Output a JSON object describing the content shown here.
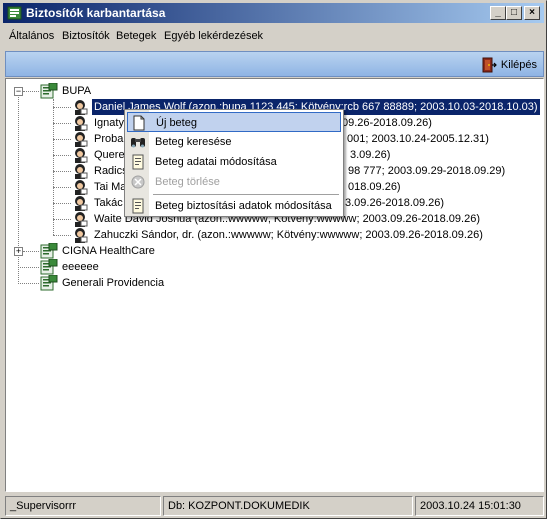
{
  "window": {
    "title": "Biztosítók karbantartása",
    "controls": {
      "minimize": "_",
      "maximize": "□",
      "close": "×"
    }
  },
  "menubar": {
    "items": [
      "Általános",
      "Biztosítók",
      "Betegek",
      "Egyéb lekérdezések"
    ]
  },
  "toolbar": {
    "exit_label": "Kilépés",
    "exit_icon": "door-exit-icon"
  },
  "tree": {
    "root_nodes": [
      {
        "label": "BUPA",
        "expanded": true,
        "children": [
          {
            "label": "Daniel James Wolf (azon.:bupa 1123 445; Kötvény:rcb 667 88889; 2003.10.03-2018.10.03)",
            "selected": true
          },
          {
            "label": "Ignaty",
            "tail": "09.26-2018.09.26)"
          },
          {
            "label": "Proba1",
            "tail": "001; 2003.10.24-2005.12.31)"
          },
          {
            "label": "Quere",
            "tail": "3.09.26)"
          },
          {
            "label": "Radics",
            "tail": "98 777; 2003.09.29-2018.09.29)"
          },
          {
            "label": "Tai Ma",
            "tail": "018.09.26)"
          },
          {
            "label": "Takác",
            "tail": "3.09.26-2018.09.26)"
          },
          {
            "label": "Waite David Joshua (azon.:wwwww; Kötvény:wwwww; 2003.09.26-2018.09.26)"
          },
          {
            "label": "Zahuczki Sándor, dr. (azon.:wwwww; Kötvény:wwwww; 2003.09.26-2018.09.26)"
          }
        ]
      },
      {
        "label": "CIGNA HealthCare",
        "expanded": false
      },
      {
        "label": "eeeeee"
      },
      {
        "label": "Generali Providencia"
      }
    ]
  },
  "context_menu": {
    "items": [
      {
        "label": "Új beteg",
        "icon": "new-document-icon",
        "enabled": true,
        "highlighted": true
      },
      {
        "label": "Beteg keresése",
        "icon": "binoculars-icon",
        "enabled": true
      },
      {
        "label": "Beteg adatai módosítása",
        "icon": "edit-document-icon",
        "enabled": true
      },
      {
        "label": "Beteg törlése",
        "icon": "delete-icon",
        "enabled": false
      },
      {
        "label": "Beteg biztosítási adatok módosítása",
        "icon": "edit-insurance-icon",
        "enabled": true
      }
    ]
  },
  "statusbar": {
    "user": "_Supervisorrr",
    "database": "Db: KOZPONT.DOKUMEDIK",
    "datetime": "2003.10.24 15:01:30"
  }
}
